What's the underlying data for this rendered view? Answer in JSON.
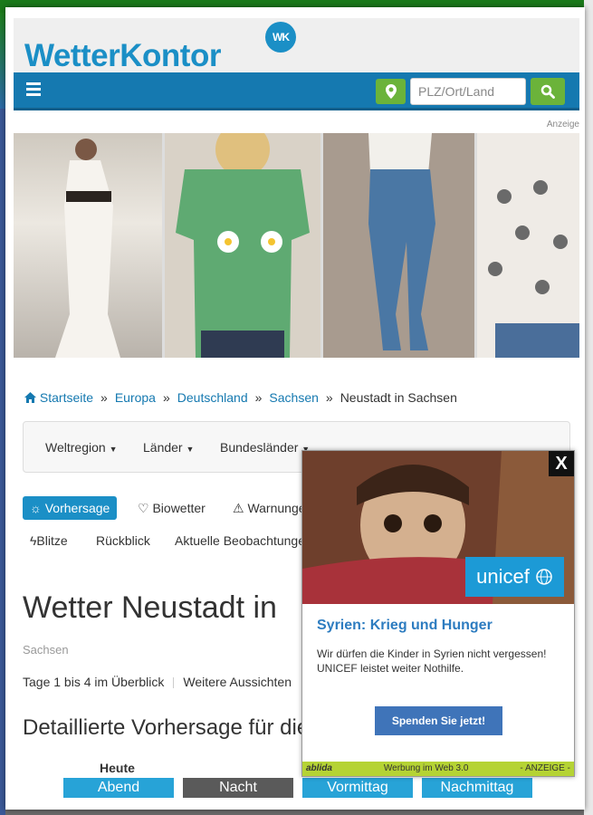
{
  "header": {
    "logo_text": "WetterKontor",
    "logo_badge": "WK",
    "search_placeholder": "PLZ/Ort/Land",
    "ad_label": "Anzeige"
  },
  "breadcrumb": {
    "items": [
      "Startseite",
      "Europa",
      "Deutschland",
      "Sachsen"
    ],
    "separator": "»",
    "current": "Neustadt in Sachsen"
  },
  "region_menu": {
    "items": [
      "Weltregion",
      "Länder",
      "Bundesländer"
    ]
  },
  "tabs": {
    "row1": [
      "Vorhersage",
      "Biowetter",
      "Warnungen"
    ],
    "row2": [
      "Blitze",
      "Rückblick",
      "Aktuelle Beobachtungen"
    ]
  },
  "main": {
    "title": "Wetter Neustadt in",
    "subtitle": "Sachsen",
    "overview_link_1": "Tage 1 bis 4 im Überblick",
    "overview_link_2": "Weitere Aussichten",
    "section_title": "Detaillierte Vorhersage für die",
    "day_label": "Heute",
    "day_buttons": [
      {
        "label": "Abend",
        "color": "#27a3d7"
      },
      {
        "label": "Nacht",
        "color": "#5a5a5a"
      },
      {
        "label": "Vormittag",
        "color": "#27a3d7"
      },
      {
        "label": "Nachmittag",
        "color": "#27a3d7"
      }
    ]
  },
  "popup": {
    "close_label": "X",
    "brand": "unicef",
    "title": "Syrien: Krieg und Hunger",
    "text": "Wir dürfen die Kinder in Syrien nicht vergessen! UNICEF leistet weiter Nothilfe.",
    "button_label": "Spenden Sie jetzt!",
    "footer_left": "ablida",
    "footer_middle": "Werbung im Web 3.0",
    "footer_right": "- ANZEIGE -"
  },
  "colors": {
    "brand_blue": "#1579b0",
    "accent_green": "#6bb33a",
    "unicef_blue": "#1c9ad6"
  }
}
